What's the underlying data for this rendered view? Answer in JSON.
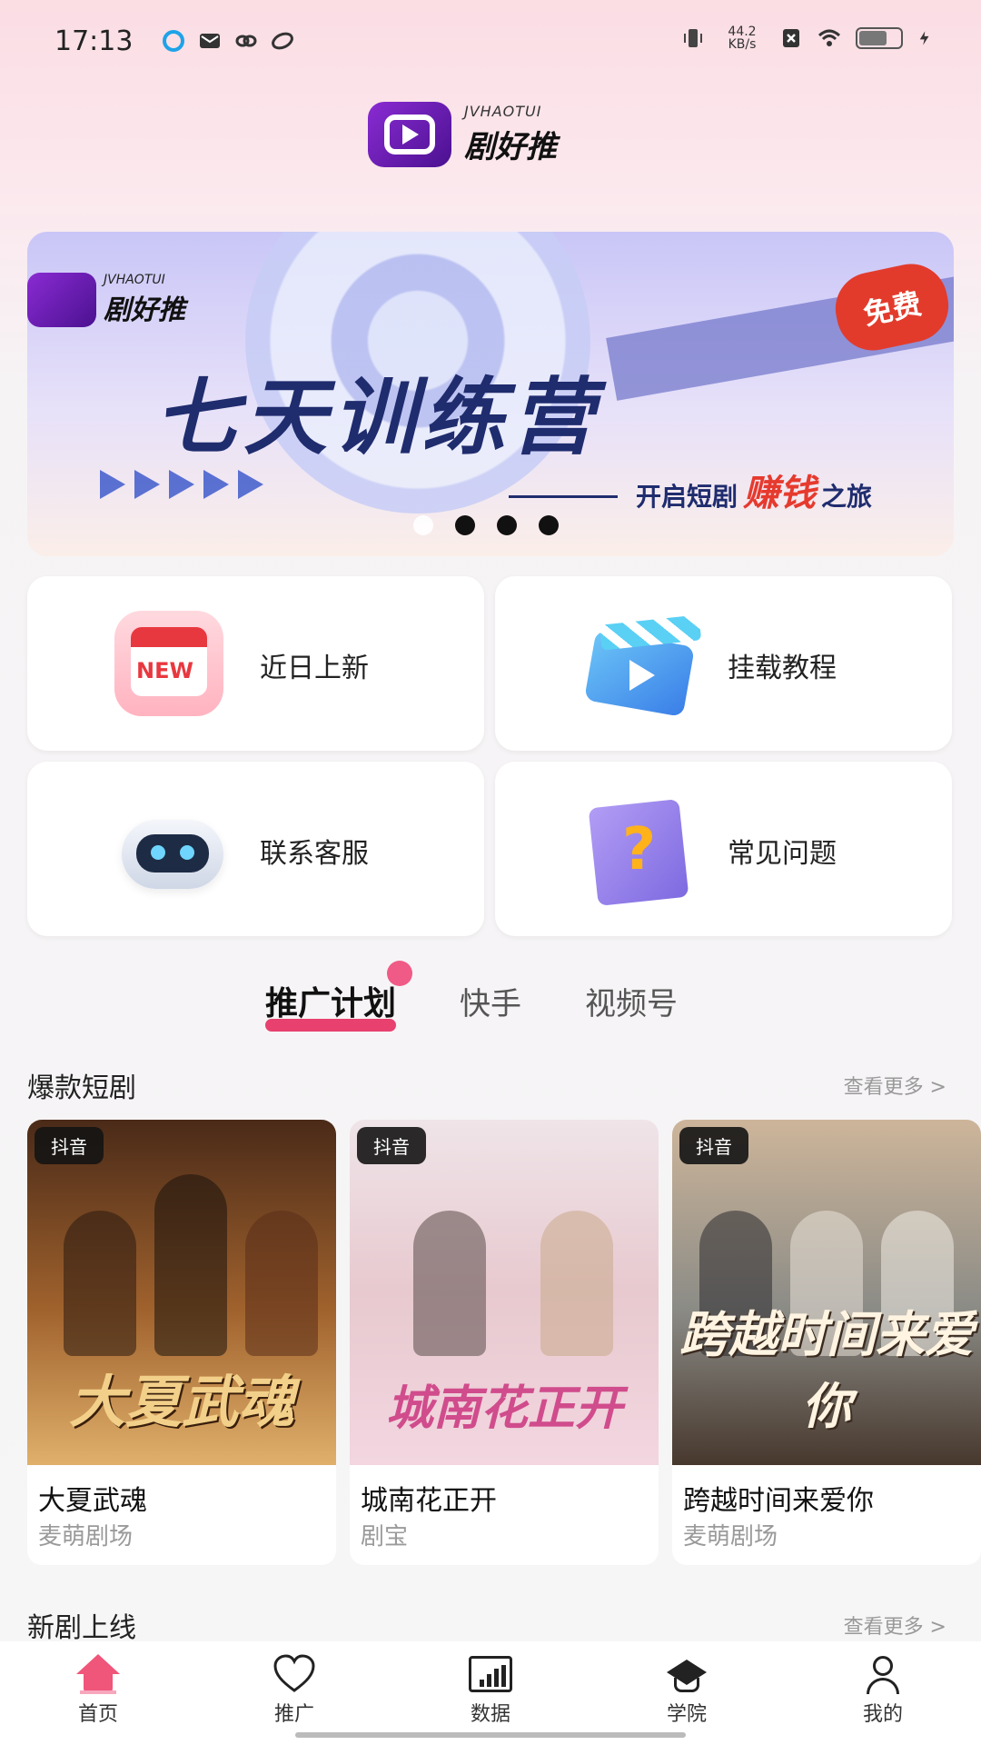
{
  "status_bar": {
    "time": "17:13",
    "net_speed_value": "44.2",
    "net_speed_unit": "KB/s",
    "left_icons": [
      "app-notification-icon",
      "mail-icon",
      "link-icon",
      "app-icon"
    ],
    "right_icons": [
      "vibrate-icon",
      "net-speed",
      "no-sim-icon",
      "wifi-icon",
      "battery-icon",
      "charging-icon"
    ]
  },
  "logo": {
    "en": "JVHAOTUI",
    "cn": "剧好推"
  },
  "banner": {
    "logo_en": "JVHAOTUI",
    "logo_cn": "剧好推",
    "title": "七天训练营",
    "subtitle_pre": "开启短剧",
    "subtitle_hot": "赚钱",
    "subtitle_post": "之旅",
    "badge": "免费",
    "dots": 4,
    "active_dot": 0
  },
  "quick_links": [
    {
      "label": "近日上新",
      "icon": "new-calendar-icon",
      "badge": "NEW"
    },
    {
      "label": "挂载教程",
      "icon": "clapperboard-play-icon"
    },
    {
      "label": "联系客服",
      "icon": "robot-support-icon"
    },
    {
      "label": "常见问题",
      "icon": "question-book-icon",
      "glyph": "?"
    }
  ],
  "tabs": [
    {
      "label": "推广计划",
      "active": true
    },
    {
      "label": "快手",
      "active": false
    },
    {
      "label": "视频号",
      "active": false
    }
  ],
  "sections": {
    "hot": {
      "title": "爆款短剧",
      "more": "查看更多 >"
    },
    "new": {
      "title": "新剧上线",
      "more": "查看更多 >"
    }
  },
  "dramas": [
    {
      "platform": "抖音",
      "poster_text": "大夏武魂",
      "title": "大夏武魂",
      "source": "麦萌剧场"
    },
    {
      "platform": "抖音",
      "poster_text": "城南花正开",
      "title": "城南花正开",
      "source": "剧宝"
    },
    {
      "platform": "抖音",
      "poster_text": "跨越时间来爱你",
      "title": "跨越时间来爱你",
      "source": "麦萌剧场"
    }
  ],
  "bottom_nav": [
    {
      "label": "首页",
      "icon": "home-icon",
      "active": true
    },
    {
      "label": "推广",
      "icon": "heart-icon",
      "active": false
    },
    {
      "label": "数据",
      "icon": "chart-icon",
      "active": false
    },
    {
      "label": "学院",
      "icon": "graduation-cap-icon",
      "active": false
    },
    {
      "label": "我的",
      "icon": "user-icon",
      "active": false
    }
  ],
  "colors": {
    "accent": "#e8416f",
    "brand_purple": "#6b1bb8",
    "banner_navy": "#1f2c6e",
    "hot_red": "#e63a2e"
  }
}
